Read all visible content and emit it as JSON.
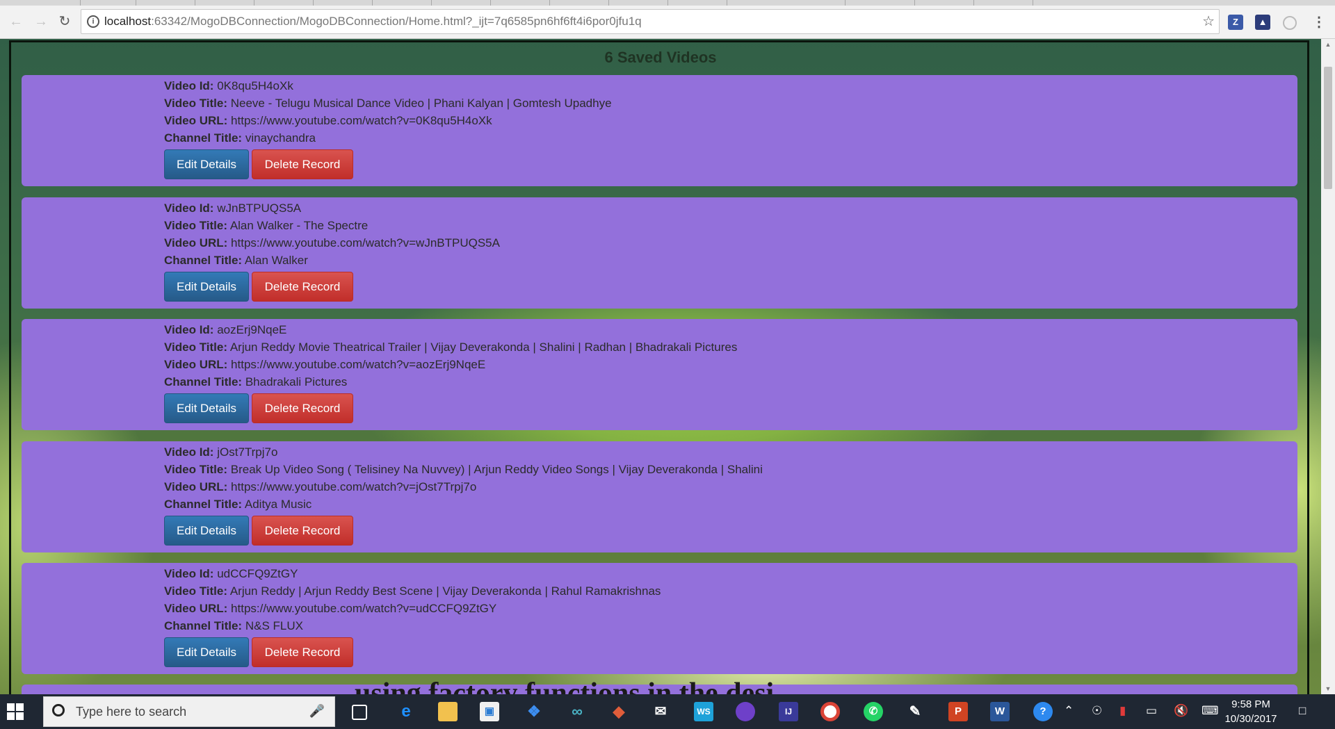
{
  "browser": {
    "address": {
      "host": "localhost",
      "rest": ":63342/MogoDBConnection/MogoDBConnection/Home.html?_ijt=7q6585pn6hf6ft4i6por0jfu1q"
    }
  },
  "page": {
    "heading": "6 Saved Videos",
    "labels": {
      "video_id": "Video Id:",
      "video_title": "Video Title:",
      "video_url": "Video URL:",
      "channel_title": "Channel Title:"
    },
    "buttons": {
      "edit": "Edit Details",
      "delete": "Delete Record"
    },
    "videos": [
      {
        "id": "0K8qu5H4oXk",
        "title": "Neeve - Telugu Musical Dance Video | Phani Kalyan | Gomtesh Upadhye",
        "url": "https://www.youtube.com/watch?v=0K8qu5H4oXk",
        "channel": "vinaychandra"
      },
      {
        "id": "wJnBTPUQS5A",
        "title": "Alan Walker - The Spectre",
        "url": "https://www.youtube.com/watch?v=wJnBTPUQS5A",
        "channel": "Alan Walker"
      },
      {
        "id": "aozErj9NqeE",
        "title": "Arjun Reddy Movie Theatrical Trailer | Vijay Deverakonda | Shalini | Radhan | Bhadrakali Pictures",
        "url": "https://www.youtube.com/watch?v=aozErj9NqeE",
        "channel": "Bhadrakali Pictures"
      },
      {
        "id": "jOst7Trpj7o",
        "title": "Break Up Video Song ( Telisiney Na Nuvvey) | Arjun Reddy Video Songs | Vijay Deverakonda | Shalini",
        "url": "https://www.youtube.com/watch?v=jOst7Trpj7o",
        "channel": "Aditya Music"
      },
      {
        "id": "udCCFQ9ZtGY",
        "title": "Arjun Reddy | Arjun Reddy Best Scene | Vijay Deverakonda | Rahul Ramakrishnas",
        "url": "https://www.youtube.com/watch?v=udCCFQ9ZtGY",
        "channel": "N&S FLUX"
      }
    ],
    "background_text": "using factory functions in the desi"
  },
  "taskbar": {
    "search_placeholder": "Type here to search",
    "time": "9:58 PM",
    "date": "10/30/2017"
  },
  "colors": {
    "card_background": "#9370db",
    "edit_button": "#337ab7",
    "delete_button": "#d9534f",
    "taskbar": "#1f2733"
  },
  "icons": {
    "back": "back-arrow-icon",
    "forward": "forward-arrow-icon",
    "reload": "reload-icon",
    "site_info": "info-icon",
    "bookmark": "star-icon"
  }
}
